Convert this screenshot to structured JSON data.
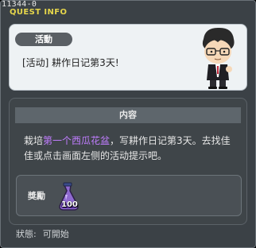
{
  "header": {
    "quest_id": "11344-0",
    "title": "QUEST INFO"
  },
  "activity": {
    "badge": "活動",
    "text": "[活动] 耕作日记第3天!"
  },
  "content": {
    "header": "内容",
    "description_parts": {
      "pre": "栽培",
      "highlight": "第一个西瓜花盆",
      "post": "，写耕作日记第3天。去找佳佳或点击画面左侧的活动提示吧。"
    },
    "reward_label": "獎勵",
    "reward_item": {
      "icon": "potion-flask-icon",
      "quantity": "100"
    }
  },
  "status": {
    "label": "狀態:",
    "value": "可開始"
  },
  "colors": {
    "title": "#e6d64b",
    "highlight": "#c07dff",
    "window_bg": "#3b4146"
  }
}
